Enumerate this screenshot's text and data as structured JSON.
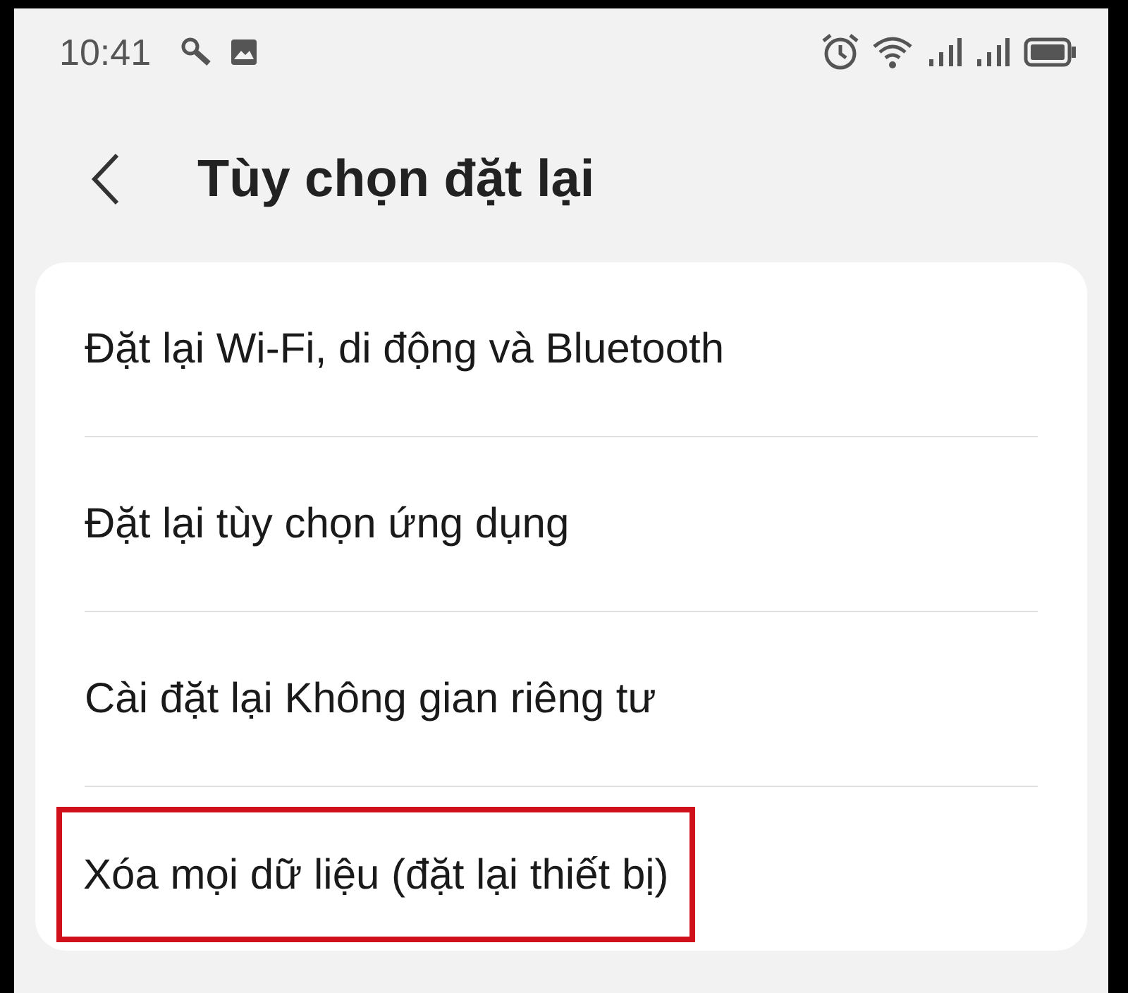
{
  "status_bar": {
    "time": "10:41"
  },
  "header": {
    "title": "Tùy chọn đặt lại"
  },
  "options": [
    {
      "label": "Đặt lại Wi-Fi, di động và Bluetooth",
      "highlighted": false
    },
    {
      "label": "Đặt lại tùy chọn ứng dụng",
      "highlighted": false
    },
    {
      "label": "Cài đặt lại Không gian riêng tư",
      "highlighted": false
    },
    {
      "label": "Xóa mọi dữ liệu (đặt lại thiết bị)",
      "highlighted": true
    }
  ]
}
